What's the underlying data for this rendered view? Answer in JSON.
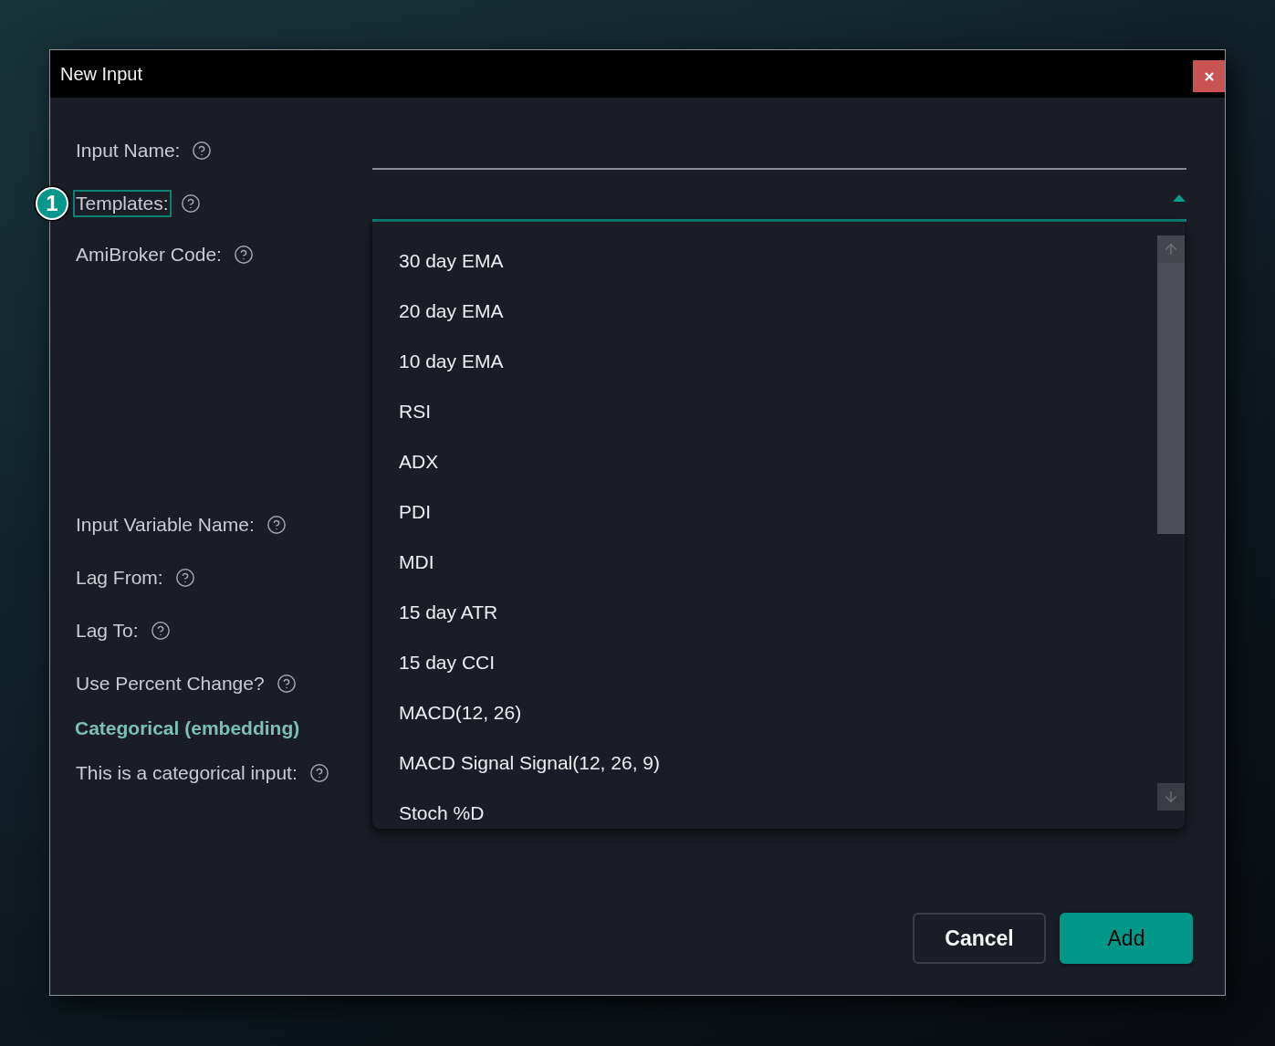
{
  "window": {
    "title": "New Input"
  },
  "form": {
    "fields": [
      {
        "kind": "text",
        "label": "Input Name:",
        "highlighted": false
      },
      {
        "kind": "select",
        "label": "Templates:",
        "highlighted": true,
        "badge": "1",
        "expanded": true
      },
      {
        "kind": "code",
        "label": "AmiBroker Code:",
        "highlighted": false
      },
      {
        "kind": "plain",
        "label": "Input Variable Name:",
        "highlighted": false
      },
      {
        "kind": "plain",
        "label": "Lag From:",
        "highlighted": false
      },
      {
        "kind": "plain",
        "label": "Lag To:",
        "highlighted": false
      },
      {
        "kind": "plain",
        "label": "Use Percent Change?",
        "highlighted": false
      },
      {
        "kind": "heading",
        "label": "Categorical (embedding)"
      },
      {
        "kind": "plain",
        "label": "This is a categorical input:",
        "highlighted": false
      }
    ]
  },
  "dropdown": {
    "options": [
      "30 day EMA",
      "20 day EMA",
      "10 day EMA",
      "RSI",
      "ADX",
      "PDI",
      "MDI",
      "15 day ATR",
      "15 day CCI",
      "MACD(12, 26)",
      "MACD Signal Signal(12, 26, 9)",
      "Stoch %D"
    ]
  },
  "buttons": [
    {
      "label": "Cancel",
      "kind": "secondary"
    },
    {
      "label": "Add",
      "kind": "primary"
    }
  ]
}
